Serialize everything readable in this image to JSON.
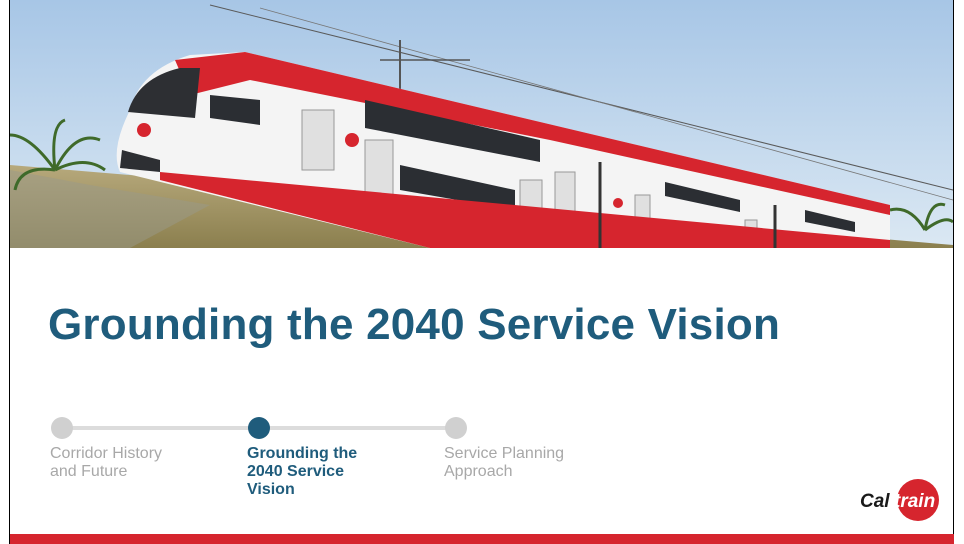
{
  "slide": {
    "title": "Grounding the 2040 Service Vision",
    "steps": [
      {
        "label_line1": "Corridor History",
        "label_line2": "and Future",
        "label_line3": "",
        "active": false
      },
      {
        "label_line1": "Grounding the",
        "label_line2": "2040 Service",
        "label_line3": "Vision",
        "active": true
      },
      {
        "label_line1": "Service Planning",
        "label_line2": "Approach",
        "label_line3": "",
        "active": false
      }
    ]
  },
  "logo": {
    "text_cal": "Cal",
    "text_train": "train"
  },
  "colors": {
    "accent": "#1f5c7c",
    "brand_red": "#d6252e",
    "inactive": "#a8a8a8"
  }
}
